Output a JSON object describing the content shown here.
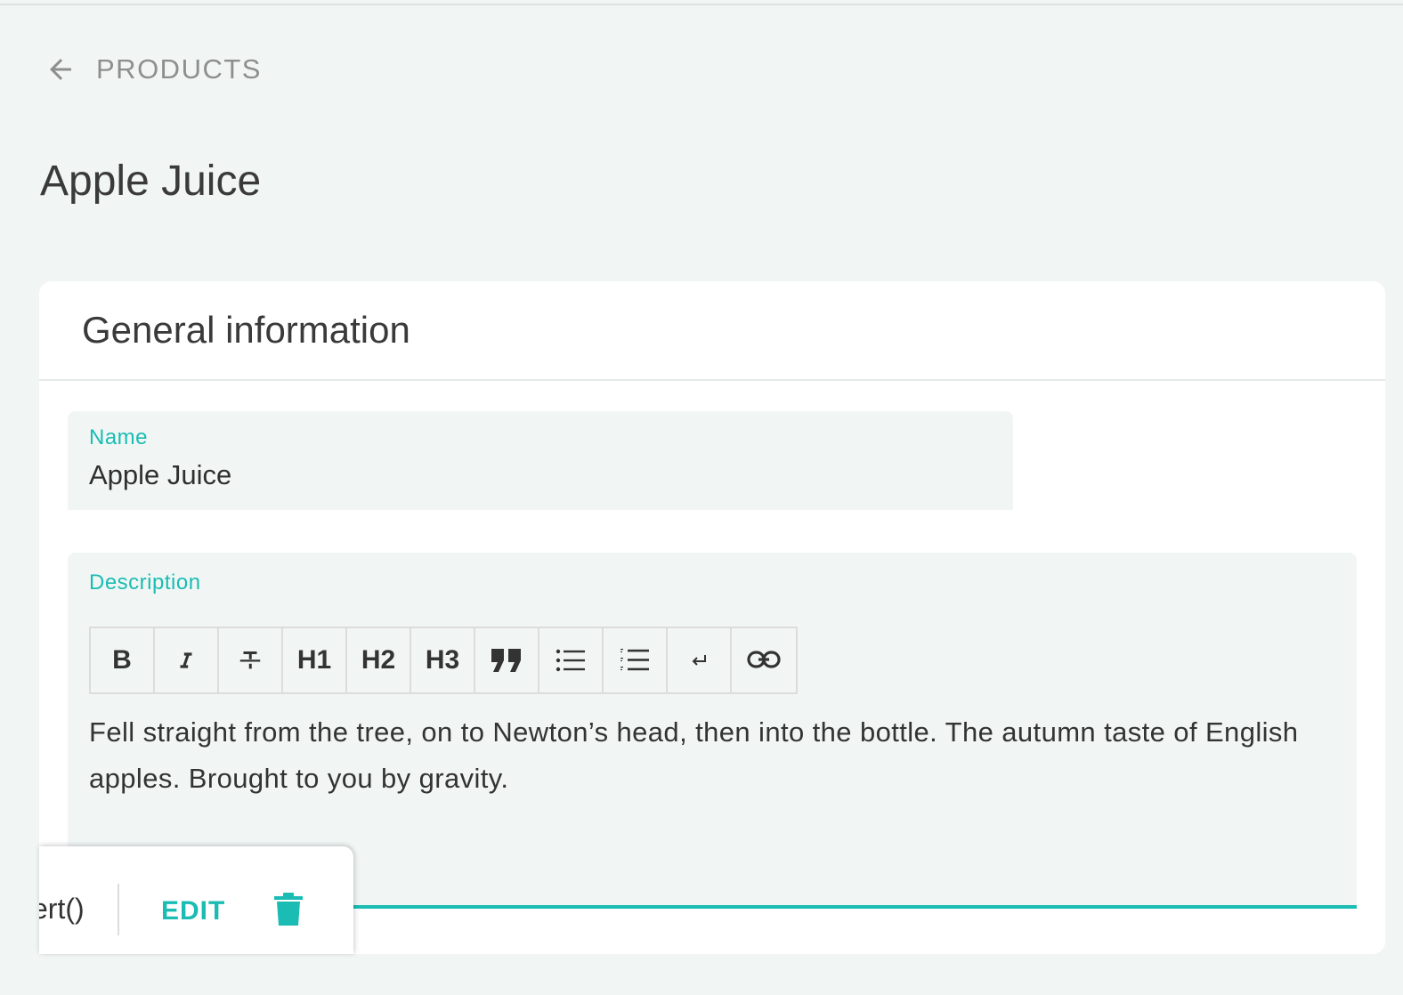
{
  "nav": {
    "back_label": "PRODUCTS"
  },
  "page": {
    "title": "Apple Juice"
  },
  "card": {
    "title": "General information",
    "name_field": {
      "label": "Name",
      "value": "Apple Juice"
    },
    "description_field": {
      "label": "Description",
      "toolbar": {
        "bold": "B",
        "h1": "H1",
        "h2": "H2",
        "h3": "H3"
      },
      "text": "Fell straight from the tree, on to Newton’s head, then into the bottle. The autumn taste of English apples. Brought to you by gravity."
    }
  },
  "floating_toolbar": {
    "code_fragment": "ert()",
    "edit_label": "EDIT"
  },
  "colors": {
    "accent": "#1abcb3",
    "background": "#f1f6f5",
    "field_background": "#f1f6f5",
    "card_background": "#ffffff",
    "muted_text": "#8e8e8e"
  },
  "icons": {
    "back": "arrow-left-icon",
    "italic": "italic-icon",
    "strikethrough": "strikethrough-icon",
    "quote": "quote-icon",
    "bullet_list": "bullet-list-icon",
    "ordered_list": "ordered-list-icon",
    "line_break": "line-break-icon",
    "link": "link-icon",
    "delete": "trash-icon"
  }
}
